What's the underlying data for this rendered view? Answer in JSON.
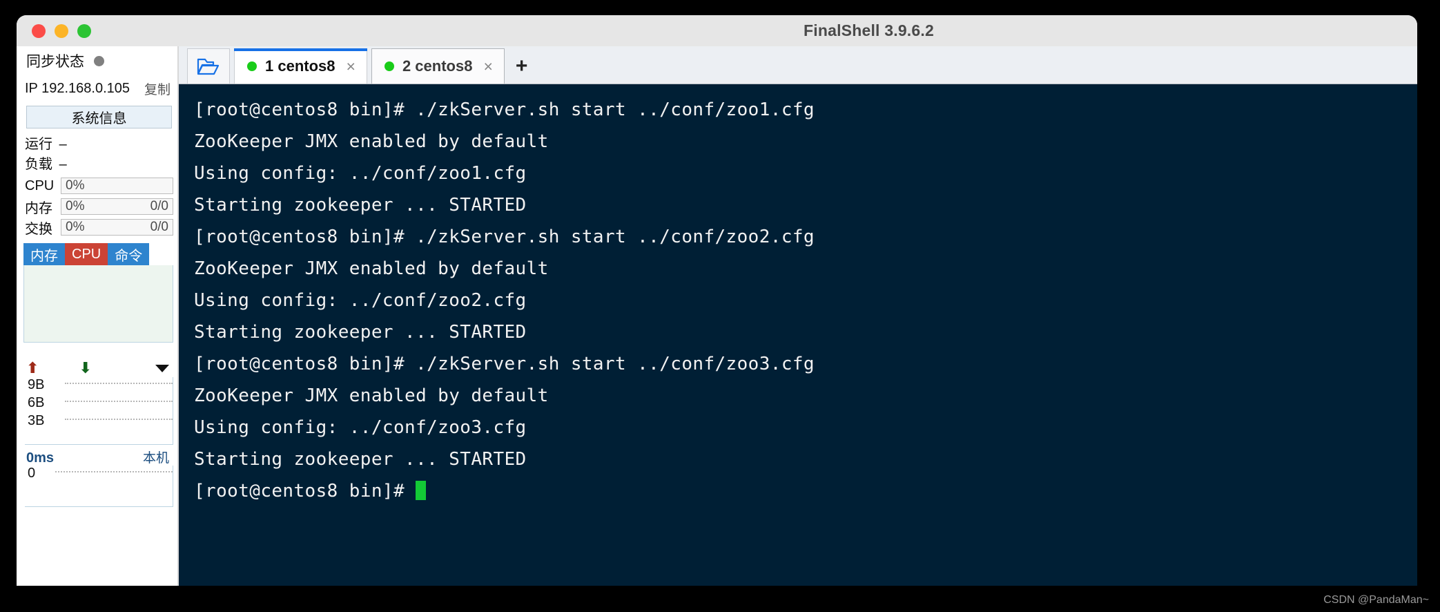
{
  "window": {
    "title": "FinalShell 3.9.6.2",
    "traffic_lights": [
      "close",
      "minimize",
      "maximize"
    ]
  },
  "sidebar": {
    "sync_label": "同步状态",
    "sync_status_color": "#808080",
    "ip_label": "IP 192.168.0.105",
    "copy_label": "复制",
    "system_info_button": "系统信息",
    "stats": [
      {
        "label": "运行",
        "value": "–"
      },
      {
        "label": "负载",
        "value": "–"
      }
    ],
    "meters": [
      {
        "label": "CPU",
        "percent": "0%",
        "detail": ""
      },
      {
        "label": "内存",
        "percent": "0%",
        "detail": "0/0"
      },
      {
        "label": "交换",
        "percent": "0%",
        "detail": "0/0"
      }
    ],
    "panel_tabs": [
      {
        "label": "内存",
        "color": "#2e84ce"
      },
      {
        "label": "CPU",
        "color": "#cb4335"
      },
      {
        "label": "命令",
        "color": "#2e84ce"
      }
    ],
    "network": {
      "upload_icon": "arrow-up-icon",
      "download_icon": "arrow-down-icon",
      "caret_icon": "chevron-down-icon",
      "y_labels": [
        "9B",
        "6B",
        "3B"
      ]
    },
    "ping": {
      "value": "0ms",
      "host": "本机",
      "y_labels": [
        "0"
      ]
    }
  },
  "tabbar": {
    "open_folder_icon": "open-folder-icon",
    "tabs": [
      {
        "label": "1 centos8",
        "active": true,
        "dot_color": "#19cc19",
        "close": "×"
      },
      {
        "label": "2 centos8",
        "active": false,
        "dot_color": "#19cc19",
        "close": "×"
      }
    ],
    "add_tab_label": "+"
  },
  "terminal": {
    "background": "#001f35",
    "foreground": "#f2f2f2",
    "cursor_color": "#13c936",
    "lines": [
      "[root@centos8 bin]# ./zkServer.sh start ../conf/zoo1.cfg",
      "ZooKeeper JMX enabled by default",
      "Using config: ../conf/zoo1.cfg",
      "Starting zookeeper ... STARTED",
      "[root@centos8 bin]# ./zkServer.sh start ../conf/zoo2.cfg",
      "ZooKeeper JMX enabled by default",
      "Using config: ../conf/zoo2.cfg",
      "Starting zookeeper ... STARTED",
      "[root@centos8 bin]# ./zkServer.sh start ../conf/zoo3.cfg",
      "ZooKeeper JMX enabled by default",
      "Using config: ../conf/zoo3.cfg",
      "Starting zookeeper ... STARTED"
    ],
    "prompt": "[root@centos8 bin]# "
  },
  "watermark": "CSDN @PandaMan~"
}
